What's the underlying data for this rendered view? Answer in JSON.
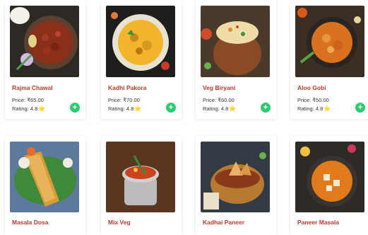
{
  "cards": [
    {
      "name": "Rajma Chawal",
      "price": "Price: ₹65.00",
      "rating": "Rating: 4.8",
      "star": "⭐",
      "add_label": "+"
    },
    {
      "name": "Kadhi Pakora",
      "price": "Price: ₹70.00",
      "rating": "Rating: 4.8",
      "star": "⭐",
      "add_label": "+"
    },
    {
      "name": "Veg Biryani",
      "price": "Price: ₹60.00",
      "rating": "Rating: 4.8",
      "star": "⭐",
      "add_label": "+"
    },
    {
      "name": "Aloo Gobi",
      "price": "Price: ₹50.00",
      "rating": "Rating: 4.8",
      "star": "⭐",
      "add_label": "+"
    },
    {
      "name": "Masala Dosa"
    },
    {
      "name": "Mix Veg"
    },
    {
      "name": "Kadhai Paneer"
    },
    {
      "name": "Paneer Masala"
    }
  ],
  "colors": {
    "title": "#c0392b",
    "add_button": "#2ecc71",
    "star": "#f1c40f"
  }
}
